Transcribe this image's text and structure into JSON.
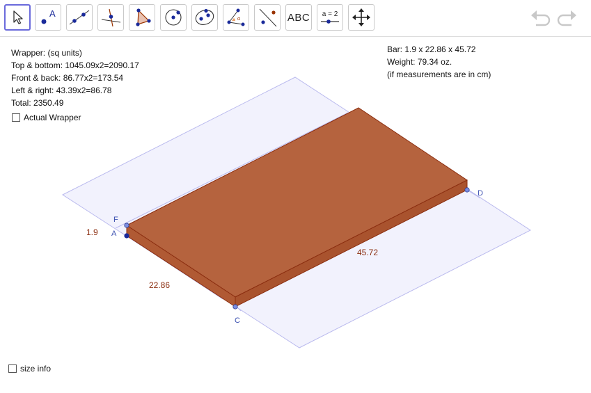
{
  "toolbar": {
    "tools": [
      {
        "name": "move-tool",
        "selected": true
      },
      {
        "name": "point-tool",
        "label": "A"
      },
      {
        "name": "line-tool"
      },
      {
        "name": "perpendicular-line-tool"
      },
      {
        "name": "polygon-tool"
      },
      {
        "name": "circle-tool"
      },
      {
        "name": "ellipse-tool"
      },
      {
        "name": "angle-tool"
      },
      {
        "name": "reflect-tool"
      },
      {
        "name": "text-tool",
        "label": "ABC"
      },
      {
        "name": "slider-tool",
        "label": "a = 2"
      },
      {
        "name": "move-graphics-view-tool"
      }
    ]
  },
  "wrapper_info": {
    "title": "Wrapper: (sq units)",
    "top_bottom": "Top & bottom: 1045.09x2=2090.17",
    "front_back": "Front & back: 86.77x2=173.54",
    "left_right": "Left & right: 43.39x2=86.78",
    "total": "Total: 2350.49"
  },
  "bar_info": {
    "dimensions": "Bar: 1.9 x 22.86 x 45.72",
    "weight": "Weight: 79.34 oz.",
    "note": "(if measurements are in cm)"
  },
  "checkboxes": {
    "actual_wrapper": {
      "label": "Actual Wrapper",
      "checked": false
    },
    "size_info": {
      "label": "size info",
      "checked": false
    }
  },
  "labels": {
    "point_f": "F",
    "point_a": "A",
    "point_c": "C",
    "point_d": "D",
    "height": "1.9",
    "width": "22.86",
    "length": "45.72"
  },
  "colors": {
    "box_fill": "#b5633e",
    "box_edge": "#8b2e10",
    "plane_fill": "#f0f0fc",
    "plane_edge": "#b8b8ea",
    "point": "#3a4fb0",
    "dimension_label": "#8b2e10",
    "point_label": "#3a4fb0"
  }
}
